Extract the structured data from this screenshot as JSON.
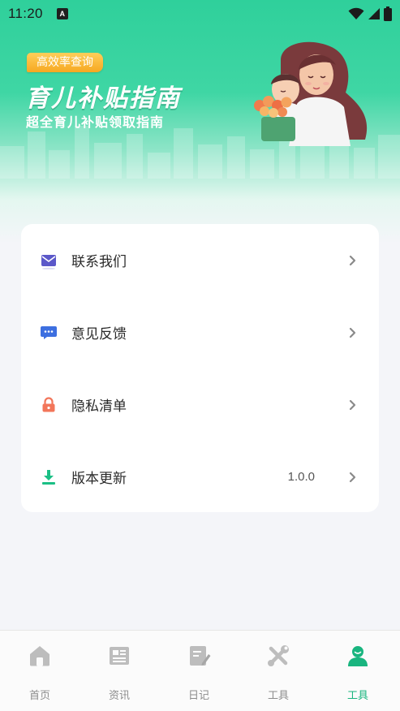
{
  "status_bar": {
    "time": "11:20",
    "notification_icon": "A"
  },
  "banner": {
    "tag": "高效率查询",
    "title": "育儿补贴指南",
    "subtitle": "超全育儿补贴领取指南",
    "illustration": "mother-and-child-with-flowers"
  },
  "menu": {
    "items": [
      {
        "label": "联系我们",
        "icon": "mail-icon",
        "icon_color": "#5b58c9"
      },
      {
        "label": "意见反馈",
        "icon": "chat-bubble-icon",
        "icon_color": "#3d6fe0"
      },
      {
        "label": "隐私清单",
        "icon": "lock-icon",
        "icon_color": "#f2765a"
      },
      {
        "label": "版本更新",
        "icon": "download-icon",
        "icon_color": "#1bbf85",
        "value": "1.0.0"
      }
    ]
  },
  "tabbar": {
    "active_index": 4,
    "active_color": "#19b57f",
    "inactive_color": "#bdbdbd",
    "tabs": [
      {
        "label": "首页",
        "icon": "home-icon"
      },
      {
        "label": "资讯",
        "icon": "news-icon"
      },
      {
        "label": "日记",
        "icon": "diary-icon"
      },
      {
        "label": "工具",
        "icon": "tools-icon"
      },
      {
        "label": "工具",
        "icon": "profile-icon"
      }
    ]
  }
}
